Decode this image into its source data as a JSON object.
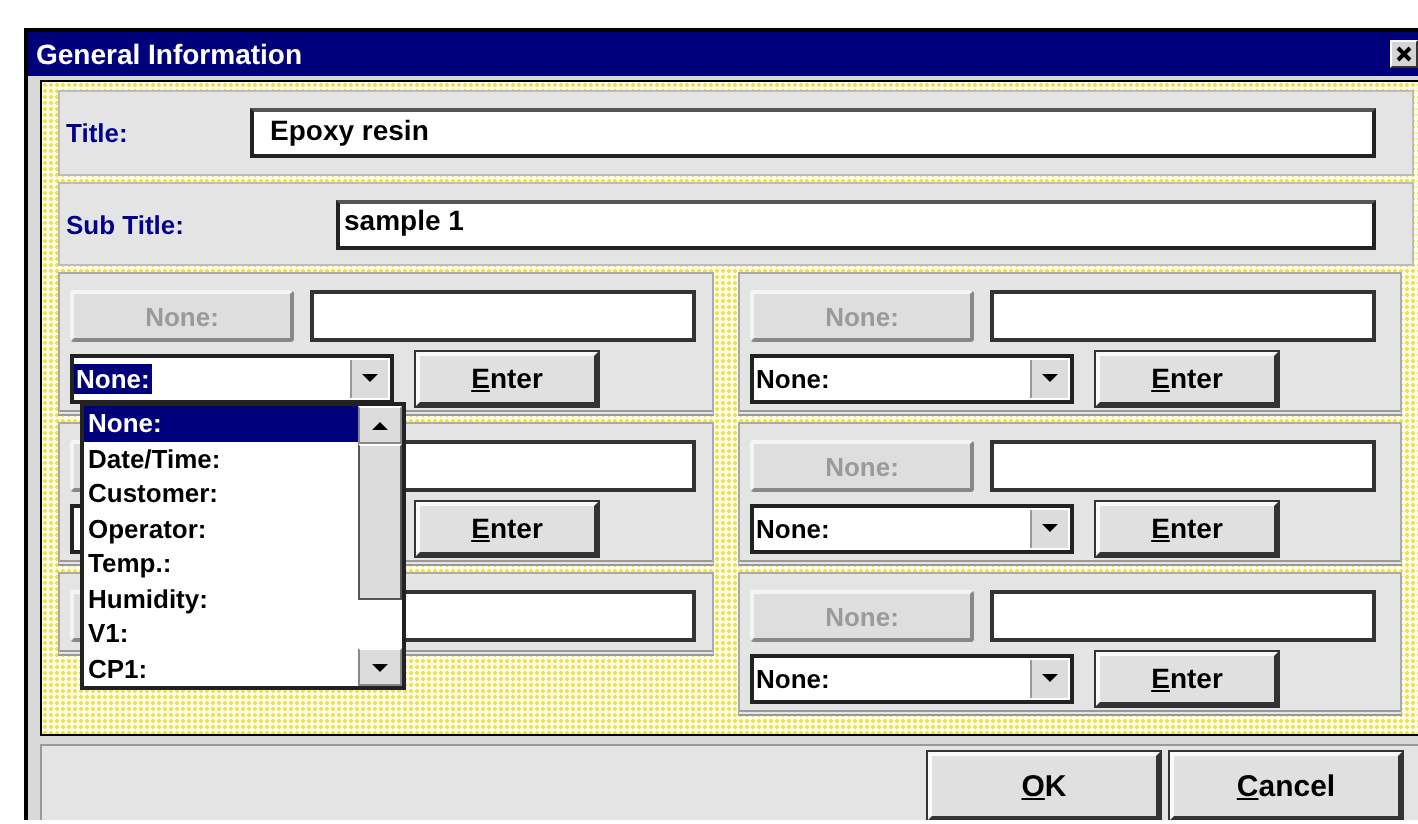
{
  "window": {
    "title": "General Information"
  },
  "title_row": {
    "label": "Title:",
    "value": "Epoxy resin"
  },
  "subtitle_row": {
    "label": "Sub Title:",
    "value": "sample 1"
  },
  "columns": [
    {
      "groups": [
        {
          "kind": "open",
          "label_button": {
            "label": "None:",
            "disabled": true
          },
          "combo": {
            "value": "None:",
            "highlighted": true
          },
          "enter_button": "Enter"
        },
        {
          "kind": "covered",
          "enter_button": "Enter"
        },
        {
          "kind": "covered"
        }
      ]
    },
    {
      "groups": [
        {
          "kind": "open",
          "label_button": {
            "label": "None:",
            "disabled": true
          },
          "combo": {
            "value": "None:",
            "highlighted": false
          },
          "enter_button": "Enter"
        },
        {
          "kind": "open",
          "label_button": {
            "label": "None:",
            "disabled": true
          },
          "combo": {
            "value": "None:",
            "highlighted": false
          },
          "enter_button": "Enter"
        },
        {
          "kind": "open",
          "label_button": {
            "label": "None:",
            "disabled": true
          },
          "combo": {
            "value": "None:",
            "highlighted": false
          },
          "enter_button": "Enter"
        }
      ]
    }
  ],
  "dropdown_list": {
    "items": [
      {
        "label": "None:",
        "selected": true
      },
      {
        "label": "Date/Time:",
        "selected": false
      },
      {
        "label": "Customer:",
        "selected": false
      },
      {
        "label": "Operator:",
        "selected": false
      },
      {
        "label": "Temp.:",
        "selected": false
      },
      {
        "label": "Humidity:",
        "selected": false
      },
      {
        "label": "V1:",
        "selected": false
      },
      {
        "label": "CP1:",
        "selected": false
      }
    ]
  },
  "buttons": [
    "OK",
    "Cancel"
  ]
}
